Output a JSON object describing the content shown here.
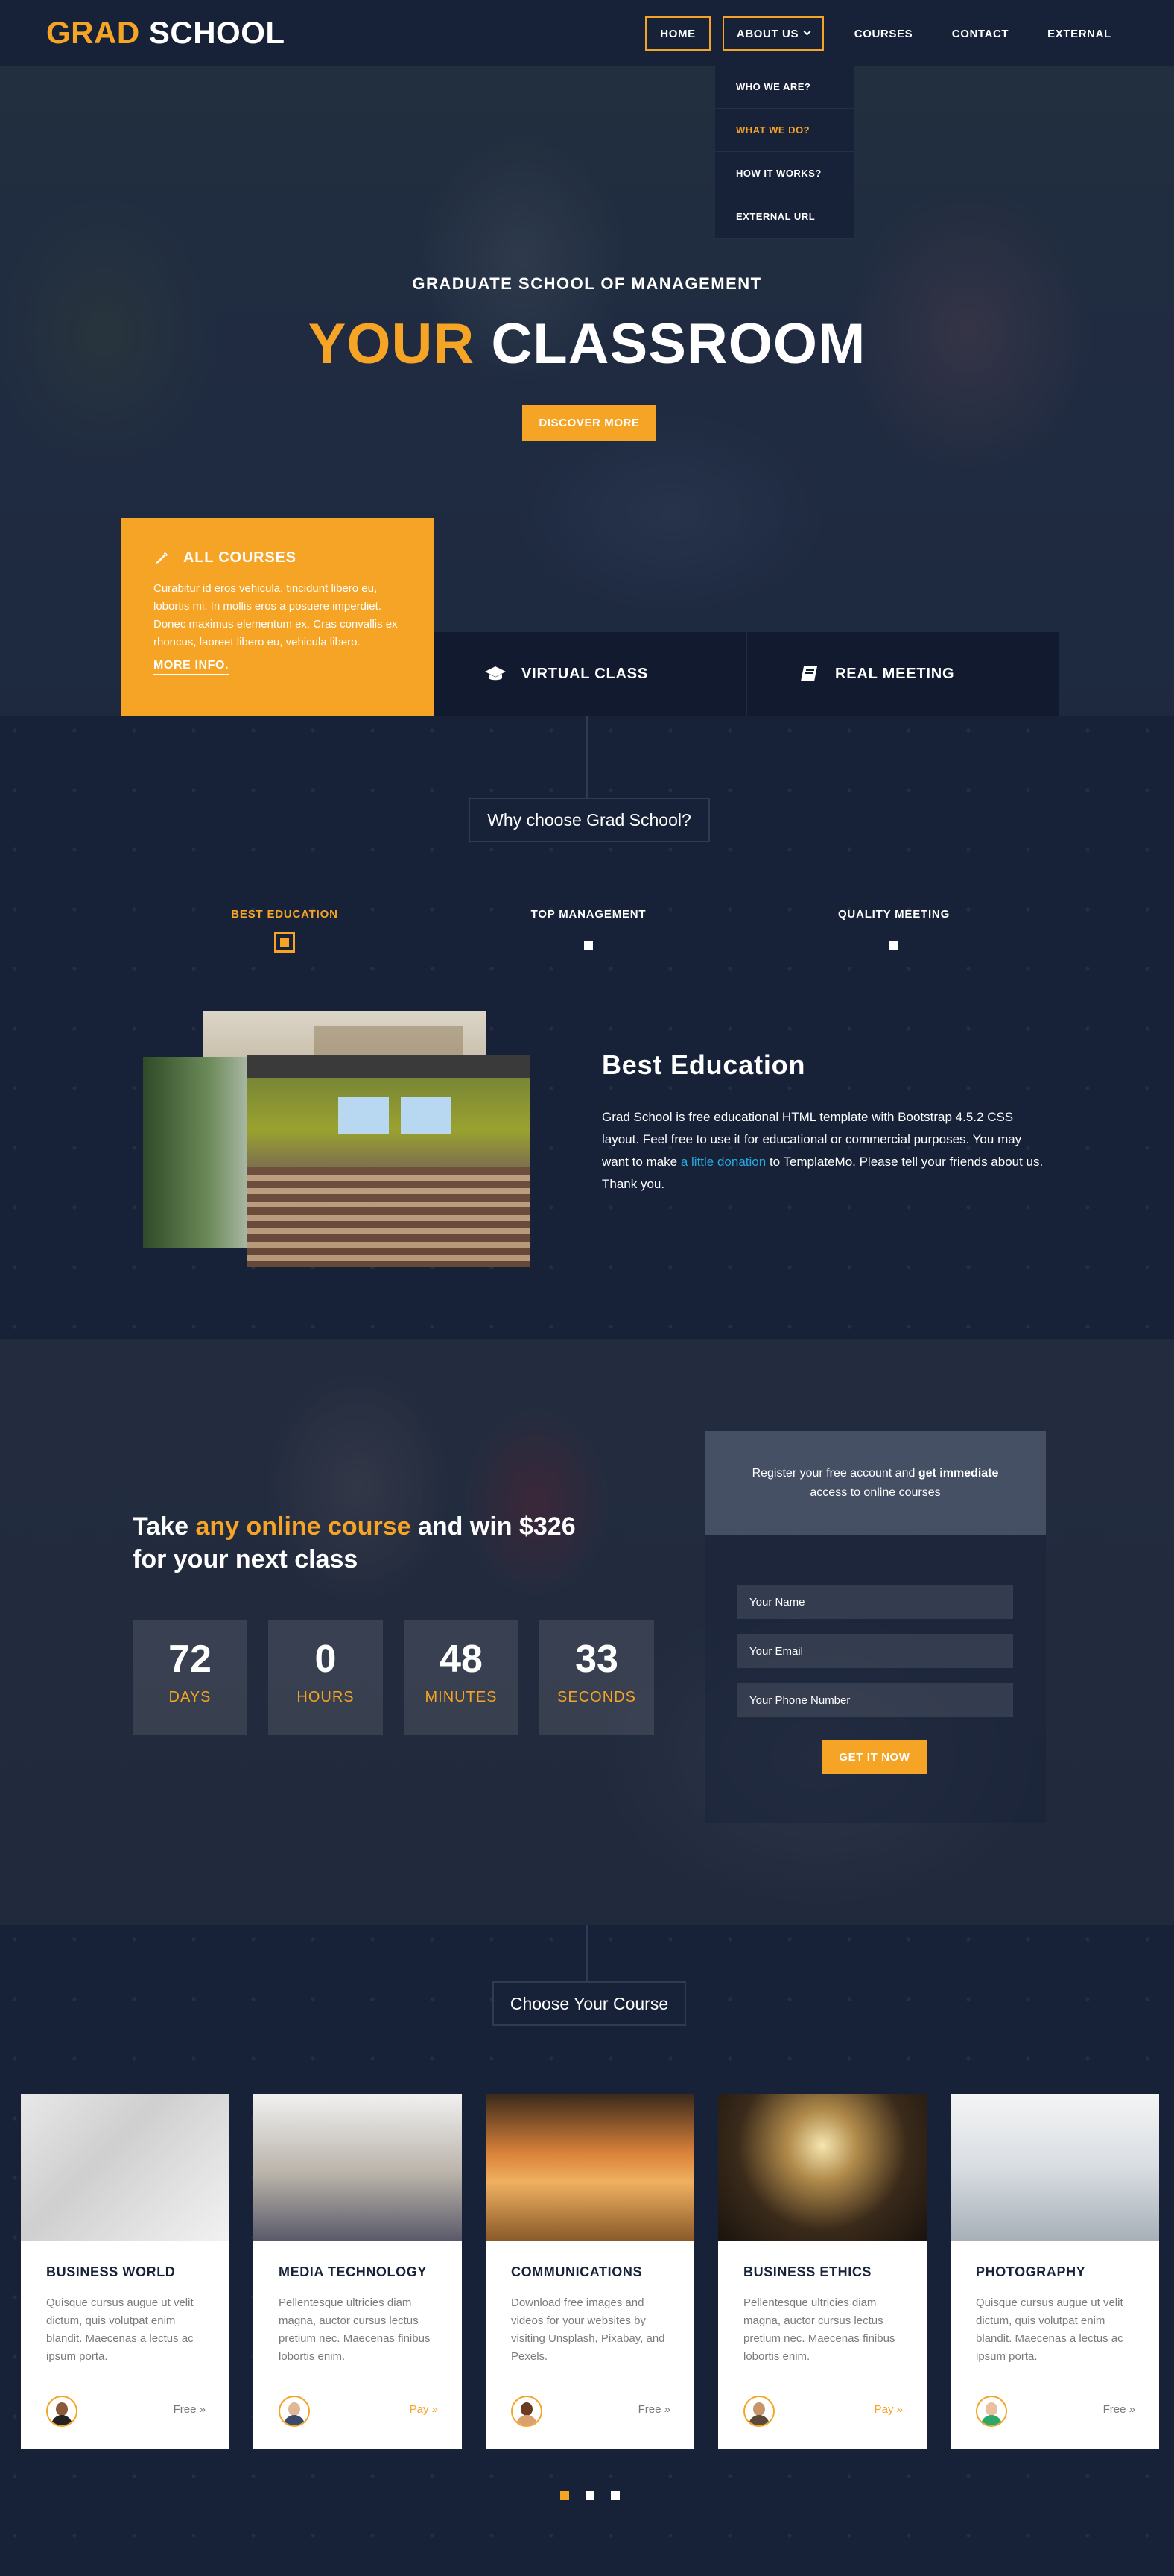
{
  "brand": {
    "part1": "GRAD",
    "part2": "SCHOOL"
  },
  "nav": {
    "home": "HOME",
    "about": "ABOUT US",
    "courses": "COURSES",
    "contact": "CONTACT",
    "external": "EXTERNAL"
  },
  "dropdown": [
    {
      "label": "WHO WE ARE?"
    },
    {
      "label": "WHAT WE DO?"
    },
    {
      "label": "HOW IT WORKS?"
    },
    {
      "label": "EXTERNAL URL"
    }
  ],
  "hero": {
    "subtitle": "GRADUATE SCHOOL OF MANAGEMENT",
    "title_highlight": "YOUR",
    "title_rest": "CLASSROOM",
    "button": "DISCOVER MORE"
  },
  "features": {
    "all_courses": {
      "title": "ALL COURSES",
      "text": "Curabitur id eros vehicula, tincidunt libero eu, lobortis mi. In mollis eros a posuere imperdiet. Donec maximus elementum ex. Cras convallis ex rhoncus, laoreet libero eu, vehicula libero.",
      "link": "MORE INFO."
    },
    "virtual_class": {
      "title": "VIRTUAL CLASS"
    },
    "real_meeting": {
      "title": "REAL MEETING"
    }
  },
  "why": {
    "section_title": "Why choose Grad School?",
    "tabs": [
      {
        "label": "BEST EDUCATION"
      },
      {
        "label": "TOP MANAGEMENT"
      },
      {
        "label": "QUALITY MEETING"
      }
    ],
    "panel": {
      "title": "Best Education",
      "text_before": "Grad School is free educational HTML template with Bootstrap 4.5.2 CSS layout. Feel free to use it for educational or commercial purposes. You may want to make",
      "link": "a little donation",
      "text_after": "to TemplateMo. Please tell your friends about us. Thank you."
    }
  },
  "countdown": {
    "head_pre": "Take",
    "head_highlight": "any online course",
    "head_post": "and win $326",
    "head_line2": "for your next class",
    "boxes": [
      {
        "value": "72",
        "label": "DAYS"
      },
      {
        "value": "0",
        "label": "HOURS"
      },
      {
        "value": "48",
        "label": "MINUTES"
      },
      {
        "value": "33",
        "label": "SECONDS"
      }
    ]
  },
  "signup": {
    "text_pre": "Register your free account and",
    "text_bold": "get immediate",
    "text_line2": "access to online courses",
    "name_placeholder": "Your Name",
    "email_placeholder": "Your Email",
    "phone_placeholder": "Your Phone Number",
    "button": "GET IT NOW"
  },
  "courses": {
    "section_title": "Choose Your Course",
    "cards": [
      {
        "title": "BUSINESS WORLD",
        "text": "Quisque cursus augue ut velit dictum, quis volutpat enim blandit. Maecenas a lectus ac ipsum porta.",
        "price": "Free »"
      },
      {
        "title": "MEDIA TECHNOLOGY",
        "text": "Pellentesque ultricies diam magna, auctor cursus lectus pretium nec. Maecenas finibus lobortis enim.",
        "price": "Pay »"
      },
      {
        "title": "COMMUNICATIONS",
        "text": "Download free images and videos for your websites by visiting Unsplash, Pixabay, and Pexels.",
        "price": "Free »"
      },
      {
        "title": "BUSINESS ETHICS",
        "text": "Pellentesque ultricies diam magna, auctor cursus lectus pretium nec. Maecenas finibus lobortis enim.",
        "price": "Pay »"
      },
      {
        "title": "PHOTOGRAPHY",
        "text": "Quisque cursus augue ut velit dictum, quis volutpat enim blandit. Maecenas a lectus ac ipsum porta.",
        "price": "Free »"
      }
    ]
  },
  "colors": {
    "accent": "#f5a425",
    "navy": "#172238",
    "link": "#29a8e0"
  }
}
